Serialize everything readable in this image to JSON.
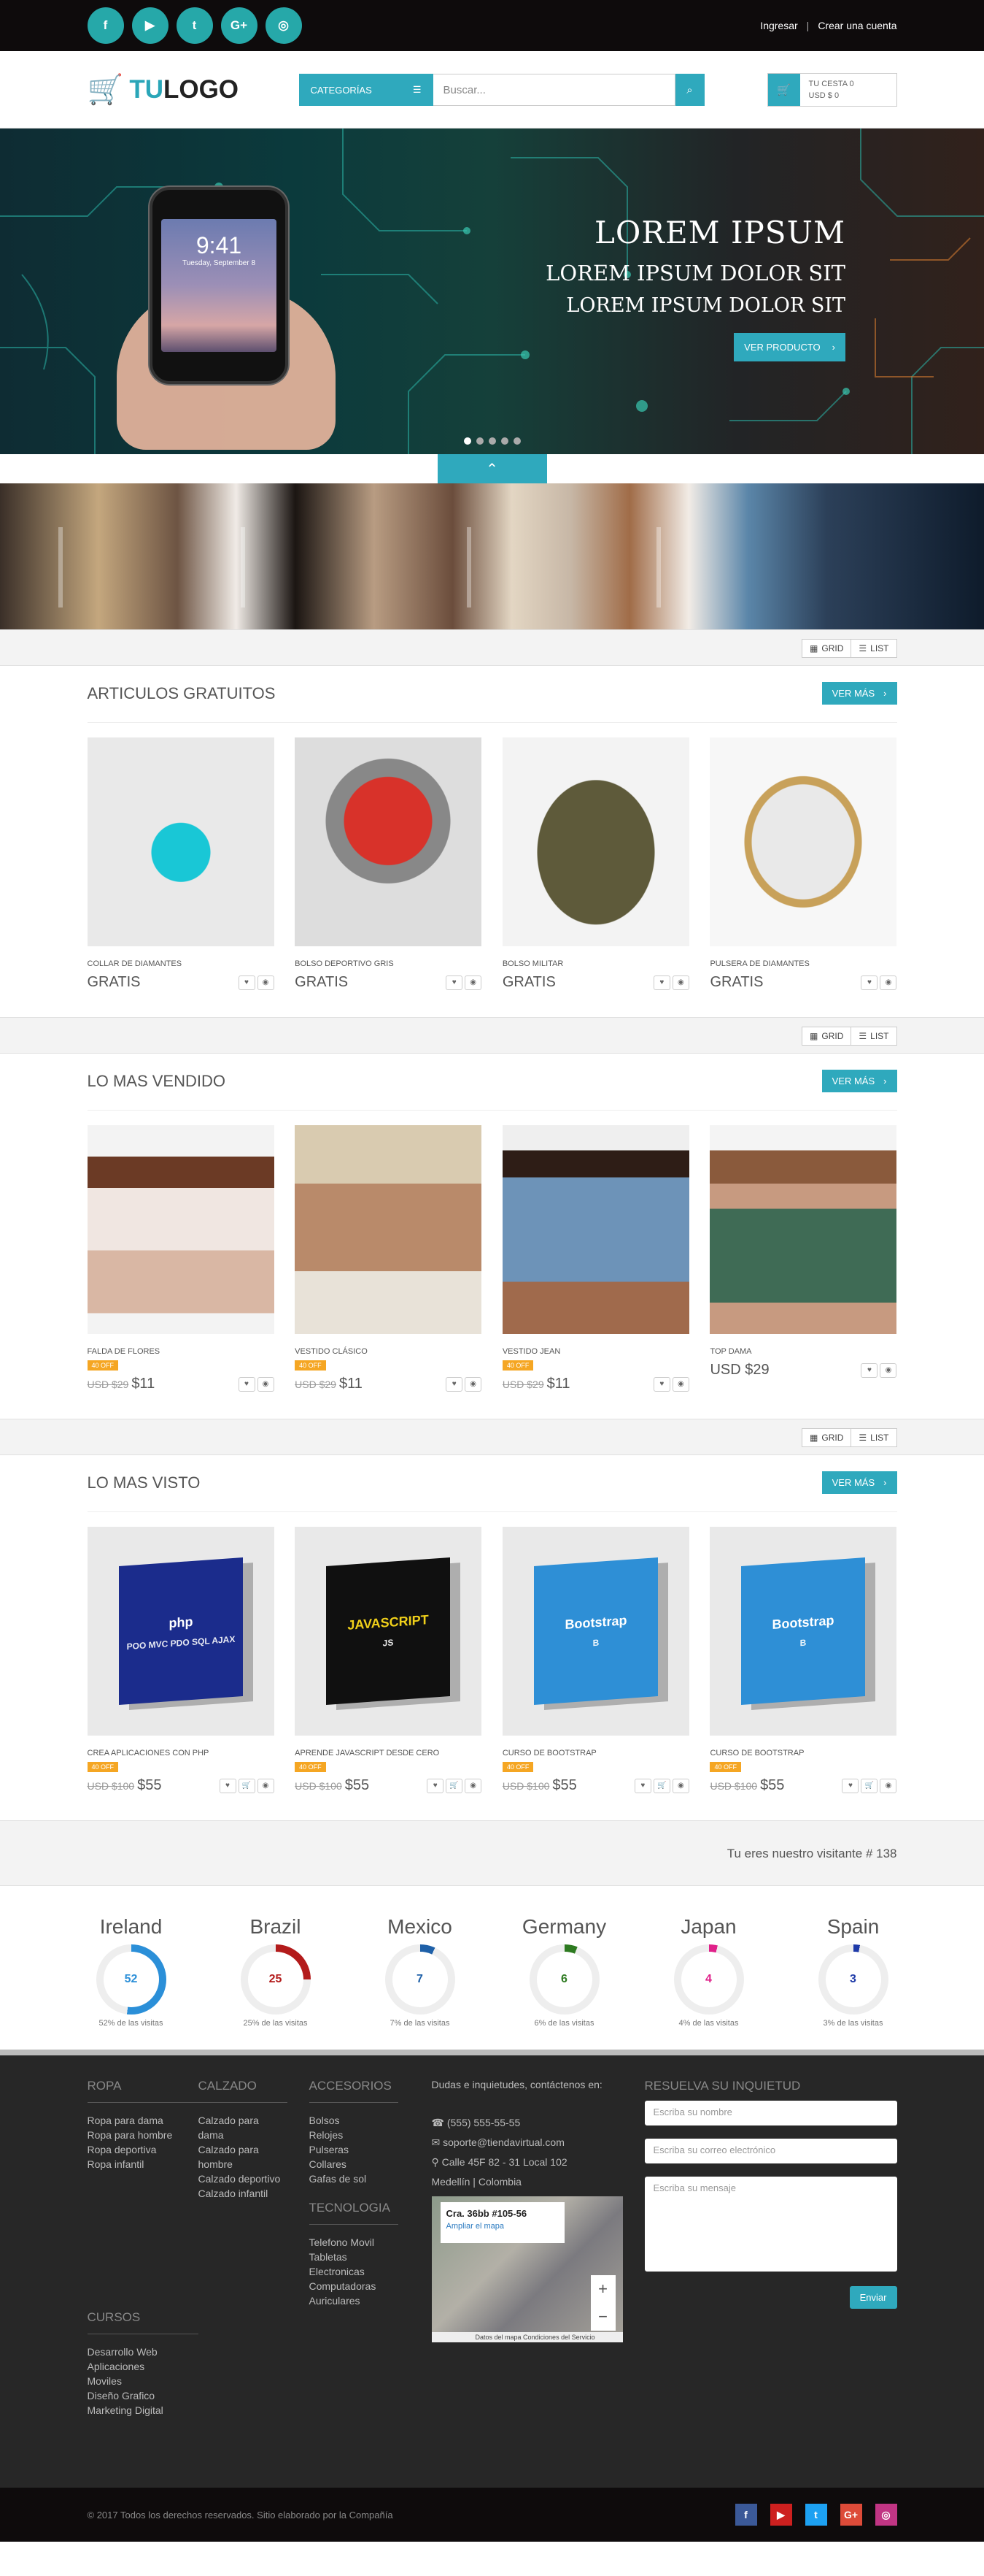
{
  "topbar": {
    "social": [
      {
        "icon": "facebook-icon",
        "glyph": "f"
      },
      {
        "icon": "youtube-icon",
        "glyph": "▶"
      },
      {
        "icon": "twitter-icon",
        "glyph": "t"
      },
      {
        "icon": "google-plus-icon",
        "glyph": "G+"
      },
      {
        "icon": "instagram-icon",
        "glyph": "◎"
      }
    ],
    "login": "Ingresar",
    "separator": "|",
    "register": "Crear una cuenta"
  },
  "header": {
    "logo_a": "TU",
    "logo_b": "LOGO",
    "categories_label": "CATEGORÍAS",
    "search_placeholder": "Buscar...",
    "basket_items": "TU CESTA 0",
    "basket_total": "USD $ 0"
  },
  "hero": {
    "title": "LOREM IPSUM",
    "line2": "LOREM IPSUM DOLOR SIT",
    "line3": "LOREM IPSUM DOLOR SIT",
    "cta": "VER PRODUCTO",
    "phone_time": "9:41",
    "phone_date": "Tuesday, September 8",
    "slides": 5,
    "active_slide": 1
  },
  "view_toggle": {
    "grid": "GRID",
    "list": "LIST"
  },
  "sections": [
    {
      "title": "ARTICULOS GRATUITOS",
      "more": "VER MÁS",
      "products": [
        {
          "name": "COLLAR DE DIAMANTES",
          "price": "GRATIS",
          "old": "",
          "badge": ""
        },
        {
          "name": "BOLSO DEPORTIVO GRIS",
          "price": "GRATIS",
          "old": "",
          "badge": ""
        },
        {
          "name": "BOLSO MILITAR",
          "price": "GRATIS",
          "old": "",
          "badge": ""
        },
        {
          "name": "PULSERA DE DIAMANTES",
          "price": "GRATIS",
          "old": "",
          "badge": ""
        }
      ]
    },
    {
      "title": "LO MAS VENDIDO",
      "more": "VER MÁS",
      "products": [
        {
          "name": "FALDA DE FLORES",
          "price": "$11",
          "old": "USD $29",
          "badge": "40 OFF"
        },
        {
          "name": "VESTIDO CLÁSICO",
          "price": "$11",
          "old": "USD $29",
          "badge": "40 OFF"
        },
        {
          "name": "VESTIDO JEAN",
          "price": "$11",
          "old": "USD $29",
          "badge": "40 OFF"
        },
        {
          "name": "TOP DAMA",
          "price": "USD $29",
          "old": "",
          "badge": ""
        }
      ]
    },
    {
      "title": "LO MAS VISTO",
      "more": "VER MÁS",
      "products": [
        {
          "name": "CREA APLICACIONES CON PHP",
          "price": "$55",
          "old": "USD $100",
          "badge": "40 OFF",
          "box": "php",
          "lines": "POO MVC PDO SQL AJAX"
        },
        {
          "name": "APRENDE JAVASCRIPT DESDE CERO",
          "price": "$55",
          "old": "USD $100",
          "badge": "40 OFF",
          "box": "JAVASCRIPT",
          "lines": "JS"
        },
        {
          "name": "CURSO DE BOOTSTRAP",
          "price": "$55",
          "old": "USD $100",
          "badge": "40 OFF",
          "box": "Bootstrap",
          "lines": "B"
        },
        {
          "name": "CURSO DE BOOTSTRAP",
          "price": "$55",
          "old": "USD $100",
          "badge": "40 OFF",
          "box": "Bootstrap",
          "lines": "B"
        }
      ]
    }
  ],
  "visits": {
    "text": "Tu eres nuestro visitante # 138",
    "countries": [
      {
        "name": "Ireland",
        "value": "52",
        "pct": 52,
        "label": "52% de las visitas",
        "color": "#2b8fd8"
      },
      {
        "name": "Brazil",
        "value": "25",
        "pct": 25,
        "label": "25% de las visitas",
        "color": "#b31b1b"
      },
      {
        "name": "Mexico",
        "value": "7",
        "pct": 7,
        "label": "7% de las visitas",
        "color": "#1e60a8"
      },
      {
        "name": "Germany",
        "value": "6",
        "pct": 6,
        "label": "6% de las visitas",
        "color": "#2d7a20"
      },
      {
        "name": "Japan",
        "value": "4",
        "pct": 4,
        "label": "4% de las visitas",
        "color": "#e0218a"
      },
      {
        "name": "Spain",
        "value": "3",
        "pct": 3,
        "label": "3% de las visitas",
        "color": "#1e3aa8"
      }
    ]
  },
  "footer": {
    "ropa": {
      "title": "ROPA",
      "items": [
        "Ropa para dama",
        "Ropa para hombre",
        "Ropa deportiva",
        "Ropa infantil"
      ]
    },
    "calzado": {
      "title": "CALZADO",
      "items": [
        "Calzado para dama",
        "Calzado para hombre",
        "Calzado deportivo",
        "Calzado infantil"
      ]
    },
    "accesorios": {
      "title": "ACCESORIOS",
      "items": [
        "Bolsos",
        "Relojes",
        "Pulseras",
        "Collares",
        "Gafas de sol"
      ]
    },
    "tecnologia": {
      "title": "TECNOLOGIA",
      "items": [
        "Telefono Movil",
        "Tabletas",
        "Electronicas",
        "Computadoras",
        "Auriculares"
      ]
    },
    "cursos": {
      "title": "CURSOS",
      "items": [
        "Desarrollo Web",
        "Aplicaciones",
        "Moviles",
        "Diseño Grafico",
        "Marketing Digital"
      ]
    },
    "contact": {
      "intro": "Dudas e inquietudes, contáctenos en:",
      "phone": "(555) 555-55-55",
      "email": "soporte@tiendavirtual.com",
      "address": "Calle 45F 82 - 31 Local 102",
      "city": "Medellín | Colombia",
      "map_title": "Cra. 36bb #105-56",
      "map_link": "Ampliar el mapa",
      "map_footer": "Datos del mapa   Condiciones del Servicio"
    },
    "form": {
      "title": "RESUELVA SU INQUIETUD",
      "name": "Escriba su nombre",
      "email": "Escriba su correo electrónico",
      "message": "Escriba su mensaje",
      "send": "Enviar"
    }
  },
  "bottom": {
    "copyright": "© 2017 Todos los derechos reservados. Sitio elaborado por la Compañía",
    "social": [
      {
        "icon": "facebook-icon",
        "glyph": "f",
        "color": "#3b5998"
      },
      {
        "icon": "youtube-icon",
        "glyph": "▶",
        "color": "#cd201f"
      },
      {
        "icon": "twitter-icon",
        "glyph": "t",
        "color": "#1da1f2"
      },
      {
        "icon": "google-plus-icon",
        "glyph": "G+",
        "color": "#dd4b39"
      },
      {
        "icon": "instagram-icon",
        "glyph": "◎",
        "color": "#c13584"
      }
    ]
  }
}
